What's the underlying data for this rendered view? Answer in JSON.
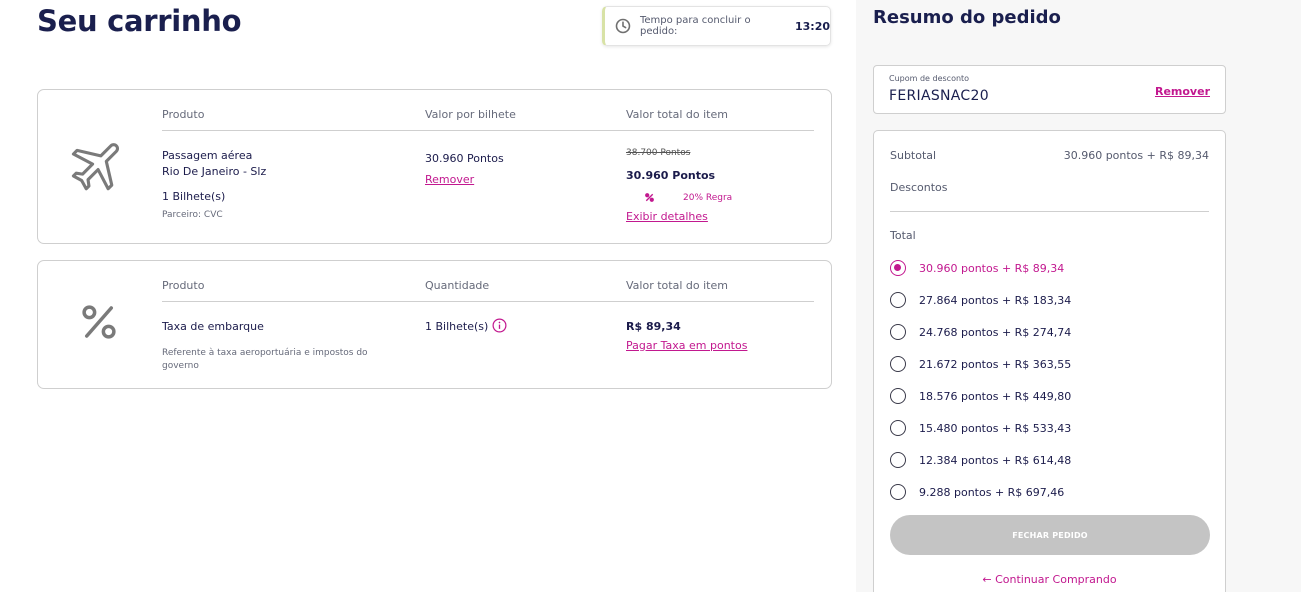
{
  "page": {
    "title": "Seu carrinho"
  },
  "timer": {
    "label": "Tempo para concluir o pedido:",
    "time": "13:20"
  },
  "flight_item": {
    "headers": {
      "product": "Produto",
      "unit_value": "Valor por bilhete",
      "total": "Valor total do item"
    },
    "name": "Passagem aérea",
    "route": "Rio De Janeiro - Slz",
    "tickets": "1 Bilhete(s)",
    "partner": "Parceiro: CVC",
    "unit_price": "30.960 Pontos",
    "remove": "Remover",
    "old_total": "38.700 Pontos",
    "total": "30.960 Pontos",
    "promo": "20% Regra",
    "details": "Exibir detalhes"
  },
  "tax_item": {
    "headers": {
      "product": "Produto",
      "quantity": "Quantidade",
      "total": "Valor total do item"
    },
    "name": "Taxa de embarque",
    "description": "Referente à taxa aeroportuária e impostos do governo",
    "quantity": "1 Bilhete(s)",
    "total": "R$ 89,34",
    "pay_points": "Pagar Taxa em pontos"
  },
  "summary": {
    "title": "Resumo do pedido",
    "coupon": {
      "label": "Cupom de desconto",
      "value": "FERIASNAC20",
      "remove": "Remover"
    },
    "subtotal_label": "Subtotal",
    "subtotal_value": "30.960 pontos + R$ 89,34",
    "discounts_label": "Descontos",
    "total_label": "Total",
    "options": [
      "30.960 pontos + R$ 89,34",
      "27.864 pontos + R$ 183,34",
      "24.768 pontos + R$ 274,74",
      "21.672 pontos + R$ 363,55",
      "18.576 pontos + R$ 449,80",
      "15.480 pontos + R$ 533,43",
      "12.384 pontos + R$ 614,48",
      "9.288 pontos + R$ 697,46"
    ],
    "selected_option": 0,
    "close_button": "FECHAR PEDIDO",
    "continue": "← Continuar Comprando"
  },
  "colors": {
    "accent": "#c2188f",
    "title": "#1a1f4e",
    "disabled_button": "#c4c4c4"
  },
  "icons": [
    "clock-icon",
    "airplane-icon",
    "percent-icon",
    "info-icon",
    "promo-icon"
  ]
}
